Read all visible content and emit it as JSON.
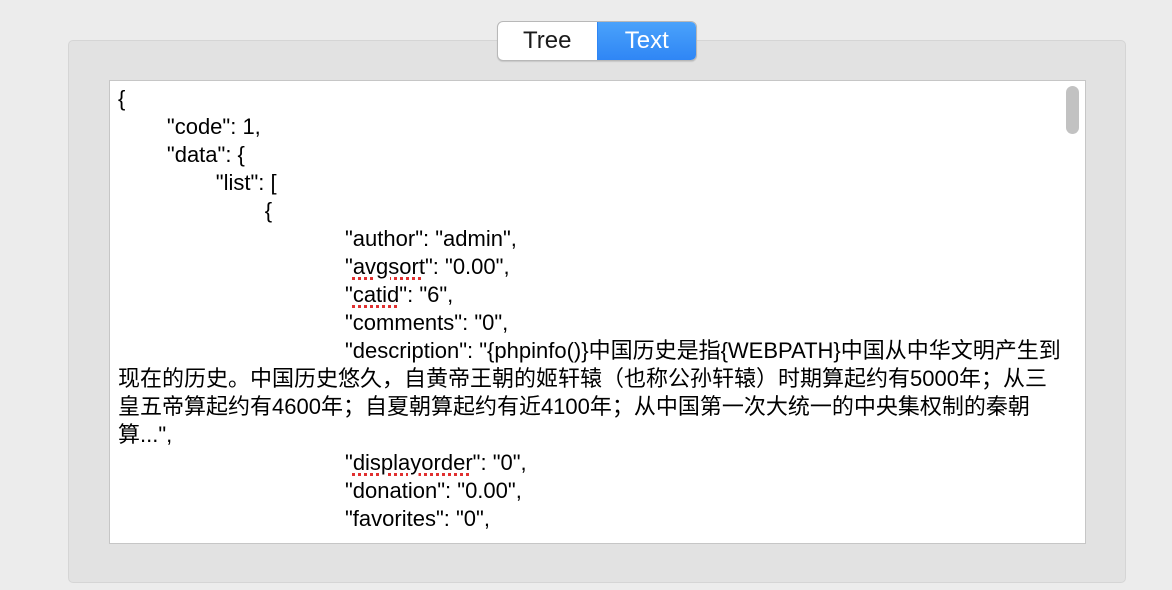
{
  "tabs": {
    "tree_label": "Tree",
    "text_label": "Text",
    "active": "Text"
  },
  "json_text": {
    "open_brace": "{",
    "code_line": "        \"code\": 1,",
    "data_line": "        \"data\": {",
    "list_line": "                \"list\": [",
    "item_open": "                        {",
    "author_line": "\"author\": \"admin\",",
    "avgsort_key": "avgsort",
    "avgsort_rest": "\": \"0.00\",",
    "catid_key": "catid",
    "catid_rest": "\": \"6\",",
    "comments_line": "\"comments\": \"0\",",
    "description_text": "\"description\": \"{phpinfo()}中国历史是指{WEBPATH}中国从中华文明产生到现在的历史。中国历史悠久，自黄帝王朝的姬轩辕（也称公孙轩辕）时期算起约有5000年；从三皇五帝算起约有4600年；自夏朝算起约有近4100年；从中国第一次大统一的中央集权制的秦朝算...\",",
    "displayorder_key": "displayorder",
    "displayorder_rest": "\": \"0\",",
    "donation_line": "\"donation\": \"0.00\",",
    "favorites_line": "\"favorites\": \"0\","
  }
}
